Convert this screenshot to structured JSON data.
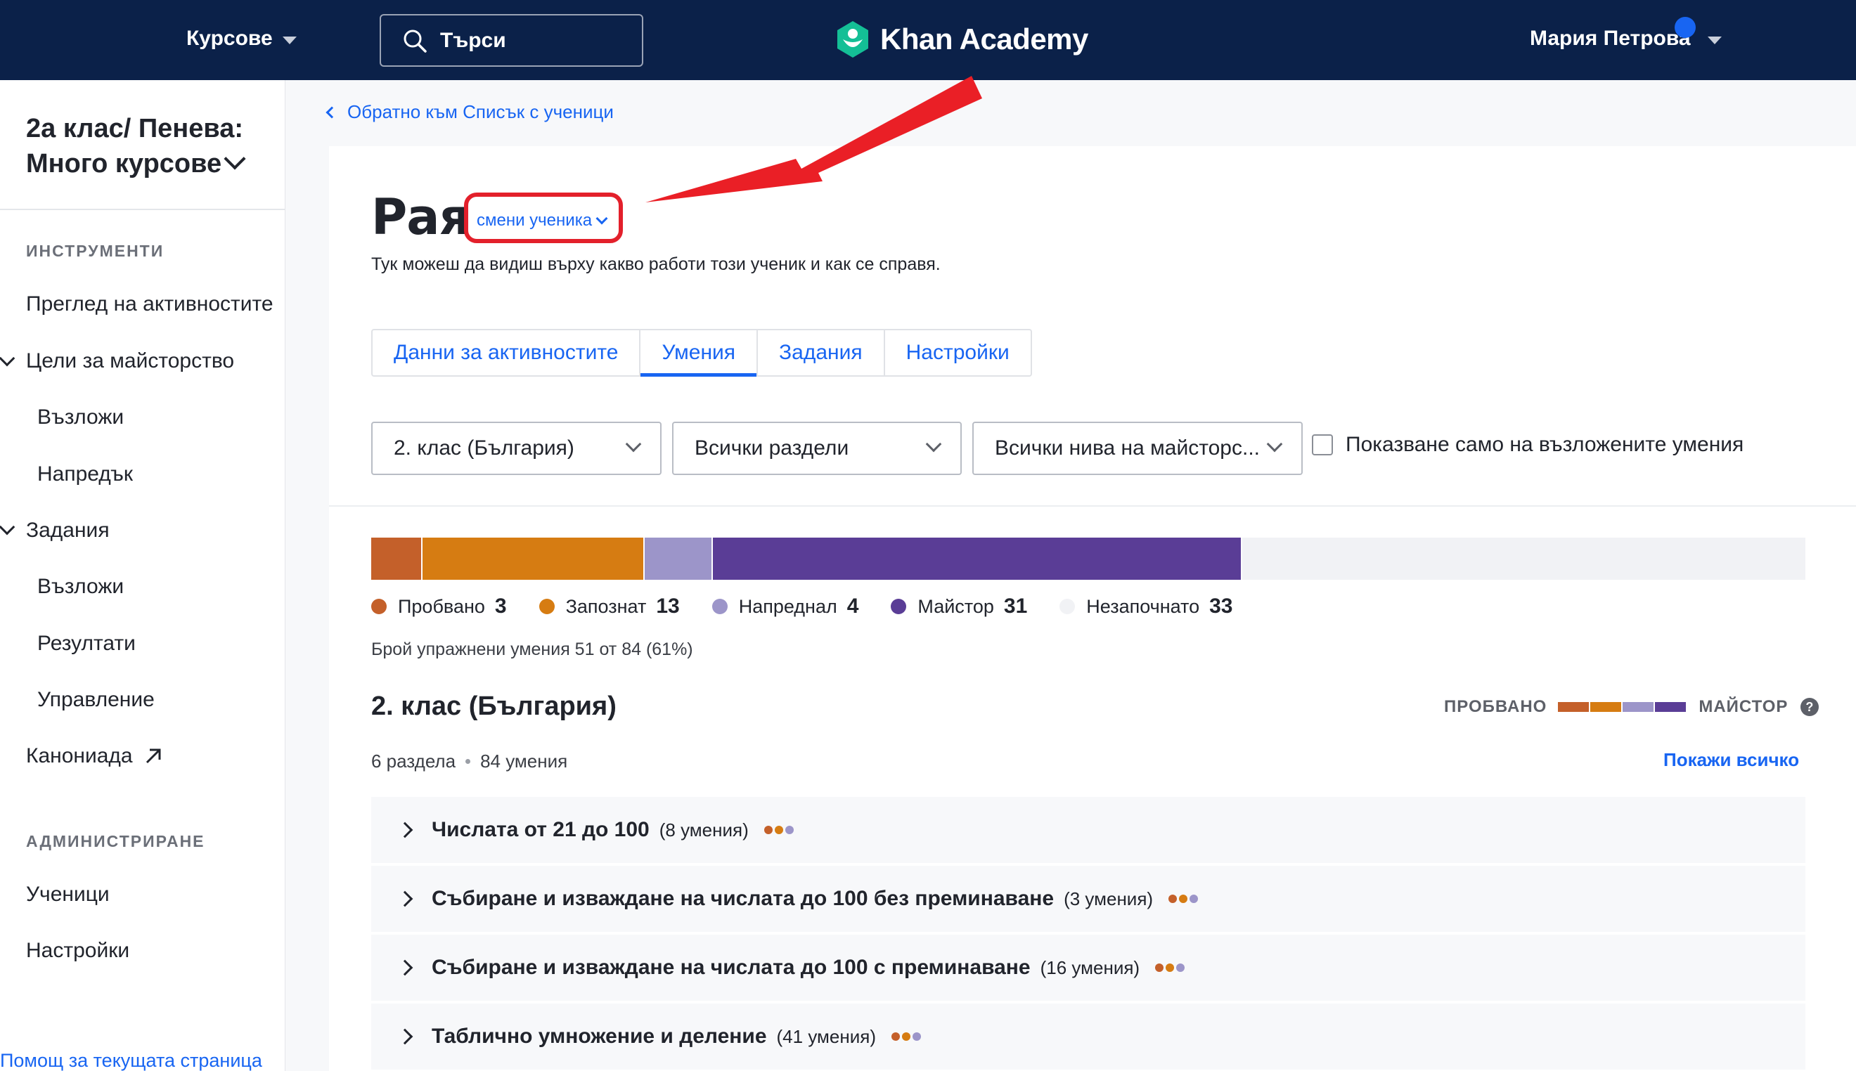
{
  "topbar": {
    "courses_label": "Курсове",
    "search_label": "Търси",
    "logo_text": "Khan Academy",
    "user_name": "Мария Петрова"
  },
  "sidebar": {
    "class_title": "2а клас/ Пенева: Много курсове",
    "section_tools": "ИНСТРУМЕНТИ",
    "items": {
      "activity": "Преглед на активностите",
      "mastery": "Цели за майсторство",
      "mastery_assign": "Възложи",
      "mastery_progress": "Напредък",
      "assignments": "Задания",
      "assign": "Възложи",
      "results": "Резултати",
      "manage": "Управление",
      "canon": "Канониада"
    },
    "section_admin": "АДМИНИСТРИРАНЕ",
    "admin_items": {
      "students": "Ученици",
      "settings": "Настройки"
    },
    "help_link": "Помощ за текущата страница"
  },
  "main": {
    "back_link": "Обратно към Списък с ученици",
    "student_name": "Рая",
    "change_student": "смени ученика",
    "subtitle": "Тук можеш да видиш върху какво работи този ученик и как се справя.",
    "tabs": [
      "Данни за активностите",
      "Умения",
      "Задания",
      "Настройки"
    ],
    "filters": {
      "course": "2. клас (България)",
      "units": "Всички раздели",
      "levels": "Всички нива на майсторс...",
      "assigned_only_label": "Показване само на възложените умения"
    },
    "progress": {
      "segments": [
        {
          "name": "Пробвано",
          "count": 3,
          "color": "#c4602a"
        },
        {
          "name": "Запознат",
          "count": 13,
          "color": "#d67c12"
        },
        {
          "name": "Напреднал",
          "count": 4,
          "color": "#9c95c9"
        },
        {
          "name": "Майстор",
          "count": 31,
          "color": "#5a3d96"
        },
        {
          "name": "Незапочнато",
          "count": 33,
          "color": "#f1f2f5"
        }
      ],
      "total": 84,
      "count_text": "Брой упражнени умения 51 от 84 (61%)"
    },
    "course_title": "2. клас (България)",
    "course_units": "6 раздела",
    "course_skills": "84 умения",
    "mastery_legend_from": "ПРОБВАНО",
    "mastery_legend_to": "МАЙСТОР",
    "help_icon": "?",
    "show_all": "Покажи всичко",
    "units": [
      {
        "title": "Числата от 21 до 100",
        "count": "(8 умения)"
      },
      {
        "title": "Събиране и изваждане на числата до 100 без преминаване",
        "count": "(3 умения)"
      },
      {
        "title": "Събиране и изваждане на числата до 100 с преминаване",
        "count": "(16 умения)"
      },
      {
        "title": "Таблично умножение и деление",
        "count": "(41 умения)"
      }
    ]
  },
  "colors": {
    "nav_bg": "#0b2149",
    "link": "#1865f2",
    "annotation_red": "#e3202b"
  },
  "icons": [
    "search-icon",
    "khan-logo-icon",
    "chevron-down-icon",
    "external-link-icon",
    "help-icon",
    "annotation-arrow"
  ]
}
